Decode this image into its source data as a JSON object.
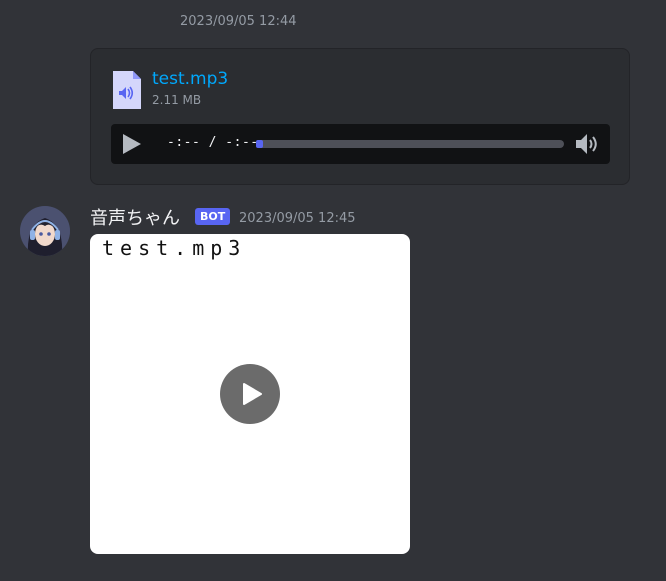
{
  "first_message": {
    "timestamp": "2023/09/05 12:44",
    "attachment": {
      "file_name": "test.mp3",
      "file_size": "2.11 MB",
      "icon": "audio-file-icon",
      "player": {
        "time": "-:-- / -:--",
        "progress": 0
      }
    }
  },
  "second_message": {
    "username": "音声ちゃん",
    "badge": "BOT",
    "timestamp": "2023/09/05 12:45",
    "video": {
      "caption": "test.mp3"
    }
  },
  "colors": {
    "background": "#313338",
    "link": "#00a8fc",
    "accent": "#5865f2"
  }
}
